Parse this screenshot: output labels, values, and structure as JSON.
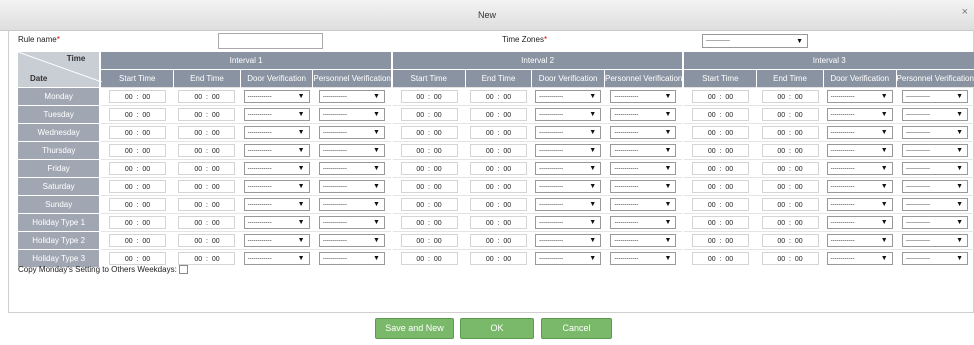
{
  "dialog": {
    "title": "New",
    "close_icon": "×"
  },
  "form": {
    "rule_name_label": "Rule name",
    "required_mark": "*",
    "rule_name_value": "",
    "time_zones_label": "Time Zones",
    "time_zones_value": "------------"
  },
  "grid": {
    "corner_time": "Time",
    "corner_date": "Date",
    "interval_labels": [
      "Interval 1",
      "Interval 2",
      "Interval 3"
    ],
    "column_labels": [
      "Start Time",
      "End Time",
      "Door Verification",
      "Personnel Verification"
    ],
    "time_value": "00  :  00",
    "select_value": "------------",
    "days": [
      "Monday",
      "Tuesday",
      "Wednesday",
      "Thursday",
      "Friday",
      "Saturday",
      "Sunday",
      "Holiday Type 1",
      "Holiday Type 2",
      "Holiday Type 3"
    ]
  },
  "copy_label": "Copy Monday's Setting to Others Weekdays:",
  "buttons": {
    "save_new": "Save and New",
    "ok": "OK",
    "cancel": "Cancel"
  },
  "colors": {
    "header": "#8a93a2",
    "day_cell": "#a0a7b2",
    "button": "#7ab96a"
  }
}
